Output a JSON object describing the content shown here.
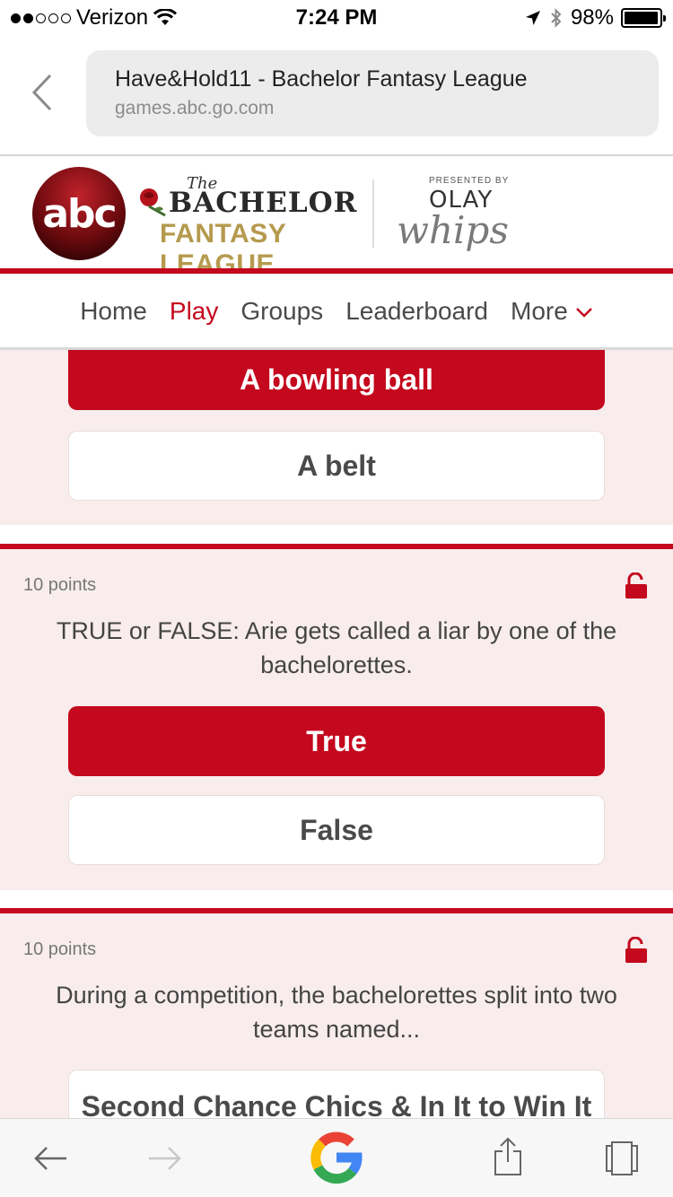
{
  "status_bar": {
    "carrier": "Verizon",
    "time": "7:24 PM",
    "battery": "98%",
    "battery_level": 0.98
  },
  "address_bar": {
    "title": "Have&Hold11 - Bachelor Fantasy League",
    "url": "games.abc.go.com"
  },
  "brand": {
    "network_logo": "abc",
    "show_the": "The",
    "show_name": "BACHELOR",
    "show_subtitle": "FANTASY LEAGUE",
    "presented_by": "PRESENTED BY",
    "sponsor": "OLAY",
    "sponsor_product": "whips"
  },
  "nav": {
    "items": [
      {
        "label": "Home"
      },
      {
        "label": "Play"
      },
      {
        "label": "Groups"
      },
      {
        "label": "Leaderboard"
      },
      {
        "label": "More"
      }
    ],
    "active": "Play"
  },
  "questions": [
    {
      "answers": [
        {
          "label": "A bowling ball",
          "selected": true
        },
        {
          "label": "A belt",
          "selected": false
        }
      ]
    },
    {
      "points": "10 points",
      "text": "TRUE or FALSE: Arie gets called a liar by one of the bachelorettes.",
      "answers": [
        {
          "label": "True",
          "selected": true
        },
        {
          "label": "False",
          "selected": false
        }
      ]
    },
    {
      "points": "10 points",
      "text": "During a competition, the bachelorettes split into two teams named...",
      "answers": [
        {
          "label": "Second Chance Chics & In It to Win It",
          "selected": false
        }
      ]
    }
  ],
  "colors": {
    "accent": "#c4081d",
    "panel_bg": "#f8eced",
    "text": "#4a4a4a"
  },
  "toolbar_icons": [
    "back-arrow-icon",
    "forward-arrow-icon",
    "google-icon",
    "share-icon",
    "tabs-icon"
  ]
}
